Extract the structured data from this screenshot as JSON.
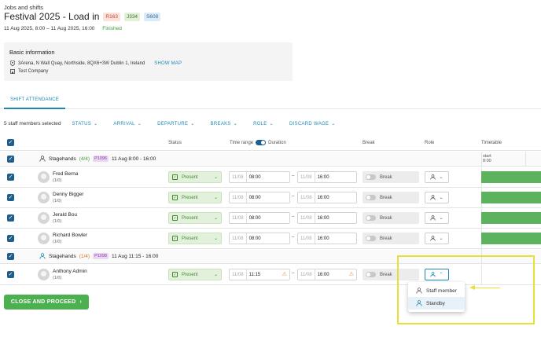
{
  "header": {
    "breadcrumb": "Jobs and shifts",
    "title": "Festival 2025 - Load in",
    "tags": [
      "R163",
      "J334",
      "S608"
    ],
    "dates": "11 Aug 2025, 8:00 – 11 Aug 2025, 16:00",
    "status": "Finished"
  },
  "info": {
    "title": "Basic information",
    "address": "3Arena, N Wall Quay, Northside, 8QX6+3W Dublin 1, Ireland",
    "show_map": "SHOW MAP",
    "company": "Test Company"
  },
  "tabs": [
    {
      "label": "SHIFT ATTENDANCE"
    }
  ],
  "filters": {
    "selected": "5 staff members selected",
    "items": [
      "STATUS",
      "ARRIVAL",
      "DEPARTURE",
      "BREAKS",
      "ROLE",
      "DISCARD WAGE"
    ]
  },
  "table": {
    "headers": {
      "status": "Status",
      "time_range": "Time range",
      "duration": "Duration",
      "break": "Break",
      "role": "Role",
      "timetable": "Timetable"
    },
    "timetable_start_label": "start",
    "timetable_start_time": "8:00",
    "groups": [
      {
        "name": "Stagehands",
        "count": "(4/4)",
        "code": "P1096",
        "time": "11 Aug 8:00 - 16:00"
      },
      {
        "name": "Stagehands",
        "count": "(1/4)",
        "code": "P1098",
        "time": "11 Aug 11:15 - 16:00"
      }
    ],
    "rows": [
      {
        "name": "Fred Berna",
        "sub": "(1/0)",
        "status": "Present",
        "date1": "11/08",
        "start": "08:00",
        "date2": "11/08",
        "end": "16:00",
        "break": "Break"
      },
      {
        "name": "Denny Bigger",
        "sub": "(1/0)",
        "status": "Present",
        "date1": "11/08",
        "start": "08:00",
        "date2": "11/08",
        "end": "16:00",
        "break": "Break"
      },
      {
        "name": "Jerald Bou",
        "sub": "(1/0)",
        "status": "Present",
        "date1": "11/08",
        "start": "08:00",
        "date2": "11/08",
        "end": "16:00",
        "break": "Break"
      },
      {
        "name": "Richard Bowler",
        "sub": "(1/0)",
        "status": "Present",
        "date1": "11/08",
        "start": "08:00",
        "date2": "11/08",
        "end": "16:00",
        "break": "Break"
      },
      {
        "name": "Anthony Admin",
        "sub": "(1/0)",
        "status": "Present",
        "date1": "11/08",
        "start": "11:15",
        "date2": "11/08",
        "end": "16:00",
        "break": "Break"
      }
    ],
    "dash": "–"
  },
  "role_dropdown": {
    "options": [
      "Staff member",
      "Standby"
    ]
  },
  "actions": {
    "close_proceed": "CLOSE AND PROCEED"
  },
  "colors": {
    "accent": "#1e88b5",
    "success": "#4caf50",
    "highlight": "#e6e039",
    "checkbox": "#1f5e8a"
  }
}
